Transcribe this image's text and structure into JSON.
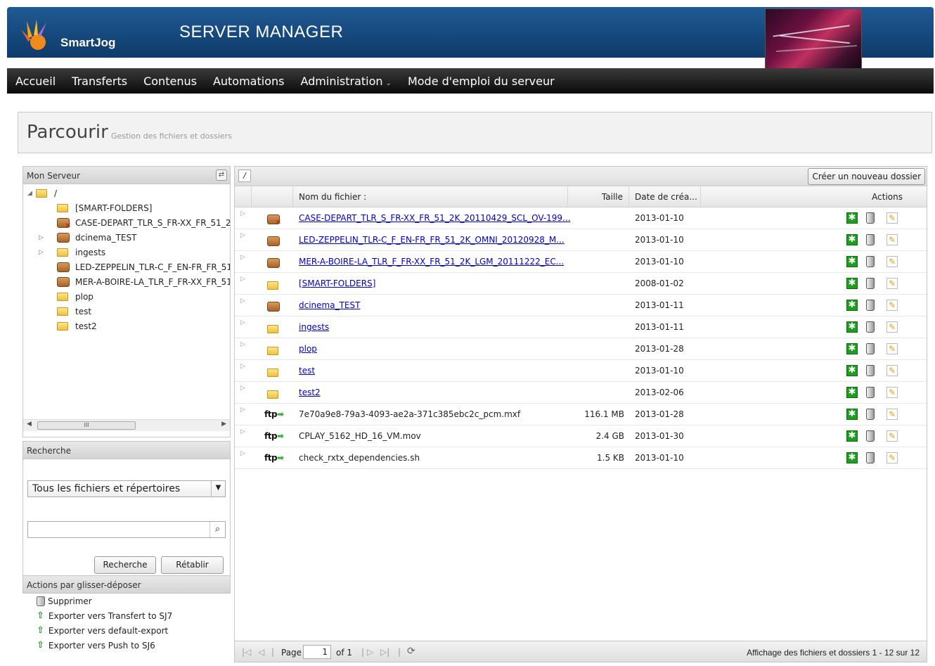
{
  "header": {
    "brand": "SmartJog",
    "app_title": "SERVER MANAGER"
  },
  "nav": {
    "items": [
      "Accueil",
      "Transferts",
      "Contenus",
      "Automations",
      "Administration",
      "Mode d'emploi du serveur"
    ]
  },
  "page": {
    "title": "Parcourir",
    "subtitle": "Gestion des fichiers et dossiers"
  },
  "tree": {
    "header": "Mon Serveur",
    "root": "/",
    "items": [
      {
        "label": "[SMART-FOLDERS]",
        "icon": "folder-icon"
      },
      {
        "label": "CASE-DEPART_TLR_S_FR-XX_FR_51_2",
        "icon": "package-error-icon"
      },
      {
        "label": "dcinema_TEST",
        "icon": "package-icon"
      },
      {
        "label": "ingests",
        "icon": "folder-icon"
      },
      {
        "label": "LED-ZEPPELIN_TLR-C_F_EN-FR_FR_51",
        "icon": "package-icon"
      },
      {
        "label": "MER-A-BOIRE-LA_TLR_F_FR-XX_FR_51",
        "icon": "package-icon"
      },
      {
        "label": "plop",
        "icon": "folder-icon"
      },
      {
        "label": "test",
        "icon": "folder-icon"
      },
      {
        "label": "test2",
        "icon": "folder-icon"
      }
    ]
  },
  "search": {
    "header": "Recherche",
    "type_value": "Tous les fichiers et répertoires",
    "query": "",
    "search_button": "Recherche",
    "reset_button": "Rétablir"
  },
  "dnd": {
    "header": "Actions par glisser-déposer",
    "items": [
      {
        "label": "Supprimer",
        "icon": "trash-icon"
      },
      {
        "label": "Exporter vers Transfert to SJ7",
        "icon": "export-arrow-icon"
      },
      {
        "label": "Exporter vers default-export",
        "icon": "export-arrow-icon"
      },
      {
        "label": "Exporter vers Push to SJ6",
        "icon": "export-arrow-icon"
      }
    ]
  },
  "grid": {
    "path": "/",
    "new_folder_button": "Créer un nouveau dossier",
    "columns": {
      "name": "Nom du fichier :",
      "size": "Taille",
      "date": "Date de créa...",
      "actions": "Actions"
    },
    "rows": [
      {
        "icon": "package-error-icon",
        "name": "CASE-DEPART_TLR_S_FR-XX_FR_51_2K_20110429_SCL_OV-199...",
        "size": "",
        "date": "2013-01-10",
        "link": true
      },
      {
        "icon": "package-icon",
        "name": "LED-ZEPPELIN_TLR-C_F_EN-FR_FR_51_2K_OMNI_20120928_M...",
        "size": "",
        "date": "2013-01-10",
        "link": true
      },
      {
        "icon": "package-icon",
        "name": "MER-A-BOIRE-LA_TLR_F_FR-XX_FR_51_2K_LGM_20111222_EC...",
        "size": "",
        "date": "2013-01-10",
        "link": true
      },
      {
        "icon": "folder-icon",
        "name": "[SMART-FOLDERS]",
        "size": "",
        "date": "2008-01-02",
        "link": true
      },
      {
        "icon": "package-icon",
        "name": "dcinema_TEST",
        "size": "",
        "date": "2013-01-11",
        "link": true
      },
      {
        "icon": "folder-icon",
        "name": "ingests",
        "size": "",
        "date": "2013-01-11",
        "link": true
      },
      {
        "icon": "folder-icon",
        "name": "plop",
        "size": "",
        "date": "2013-01-28",
        "link": true
      },
      {
        "icon": "folder-icon",
        "name": "test",
        "size": "",
        "date": "2013-01-10",
        "link": true
      },
      {
        "icon": "folder-icon",
        "name": "test2",
        "size": "",
        "date": "2013-02-06",
        "link": true
      },
      {
        "icon": "ftp-icon",
        "name": "7e70a9e8-79a3-4093-ae2a-371c385ebc2c_pcm.mxf",
        "size": "116.1 MB",
        "date": "2013-01-28",
        "link": false
      },
      {
        "icon": "ftp-icon",
        "name": "CPLAY_5162_HD_16_VM.mov",
        "size": "2.4 GB",
        "date": "2013-01-30",
        "link": false
      },
      {
        "icon": "ftp-icon",
        "name": "check_rxtx_dependencies.sh",
        "size": "1.5 KB",
        "date": "2013-01-10",
        "link": false
      }
    ]
  },
  "pager": {
    "page_label": "Page",
    "page_value": "1",
    "of_label": "of 1",
    "info": "Affichage des fichiers et dossiers 1 - 12 sur 12"
  },
  "icons": {
    "ftp_text": "ftp"
  }
}
